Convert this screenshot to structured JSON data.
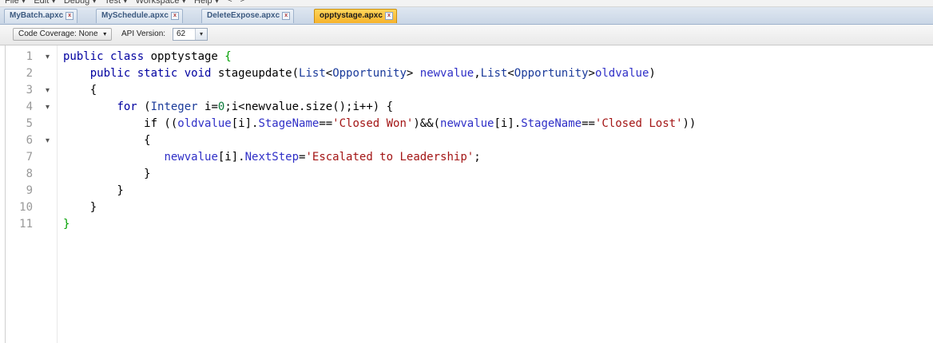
{
  "menu": [
    "File ▾",
    "Edit ▾",
    "Debug ▾",
    "Test ▾",
    "Workspace ▾",
    "Help ▾",
    "<",
    ">"
  ],
  "tabs": [
    {
      "label": "MyBatch.apxc",
      "active": false
    },
    {
      "label": "MySchedule.apxc",
      "active": false
    },
    {
      "label": "DeleteExpose.apxc",
      "active": false
    },
    {
      "label": "opptystage.apxc",
      "active": true
    }
  ],
  "toolbar": {
    "coverage_label": "Code Coverage: None",
    "api_label": "API Version:",
    "api_value": "62"
  },
  "editor": {
    "line_numbers": [
      "1",
      "2",
      "3",
      "4",
      "5",
      "6",
      "7",
      "8",
      "9",
      "10",
      "11"
    ],
    "fold_markers": [
      "▾",
      "",
      "▾",
      "▾",
      "",
      "▾",
      "",
      "",
      "",
      "",
      ""
    ],
    "lines": [
      [
        [
          "kw",
          "public class "
        ],
        [
          "",
          "opptystage "
        ],
        [
          "brace-hl",
          "{"
        ]
      ],
      [
        [
          "",
          "    "
        ],
        [
          "kw",
          "public static void "
        ],
        [
          "",
          "stageupdate("
        ],
        [
          "id",
          "List"
        ],
        [
          "",
          "<"
        ],
        [
          "id",
          "Opportunity"
        ],
        [
          "",
          "> "
        ],
        [
          "var",
          "newvalue"
        ],
        [
          "",
          ","
        ],
        [
          "id",
          "List"
        ],
        [
          "",
          "<"
        ],
        [
          "id",
          "Opportunity"
        ],
        [
          "",
          ">"
        ],
        [
          "var",
          "oldvalue"
        ],
        [
          "",
          ")"
        ]
      ],
      [
        [
          "",
          "    {"
        ]
      ],
      [
        [
          "",
          "        "
        ],
        [
          "kw",
          "for "
        ],
        [
          "",
          "("
        ],
        [
          "id",
          "Integer "
        ],
        [
          "",
          "i="
        ],
        [
          "num",
          "0"
        ],
        [
          "",
          ";i<newvalue.size();i++) {"
        ]
      ],
      [
        [
          "",
          "            if (("
        ],
        [
          "var",
          "oldvalue"
        ],
        [
          "",
          "[i]."
        ],
        [
          "var",
          "StageName"
        ],
        [
          "",
          "=="
        ],
        [
          "str",
          "'Closed Won'"
        ],
        [
          "",
          ")&&("
        ],
        [
          "var",
          "newvalue"
        ],
        [
          "",
          "[i]."
        ],
        [
          "var",
          "StageName"
        ],
        [
          "",
          "=="
        ],
        [
          "str",
          "'Closed Lost'"
        ],
        [
          "",
          "))"
        ]
      ],
      [
        [
          "",
          "            {"
        ]
      ],
      [
        [
          "",
          "               "
        ],
        [
          "var",
          "newvalue"
        ],
        [
          "",
          "[i]."
        ],
        [
          "var",
          "NextStep"
        ],
        [
          "",
          "="
        ],
        [
          "str",
          "'Escalated to Leadership'"
        ],
        [
          "",
          ";"
        ]
      ],
      [
        [
          "",
          "            }"
        ]
      ],
      [
        [
          "",
          "        }"
        ]
      ],
      [
        [
          "",
          "    }"
        ]
      ],
      [
        [
          "brace-hl",
          "}"
        ]
      ]
    ]
  }
}
